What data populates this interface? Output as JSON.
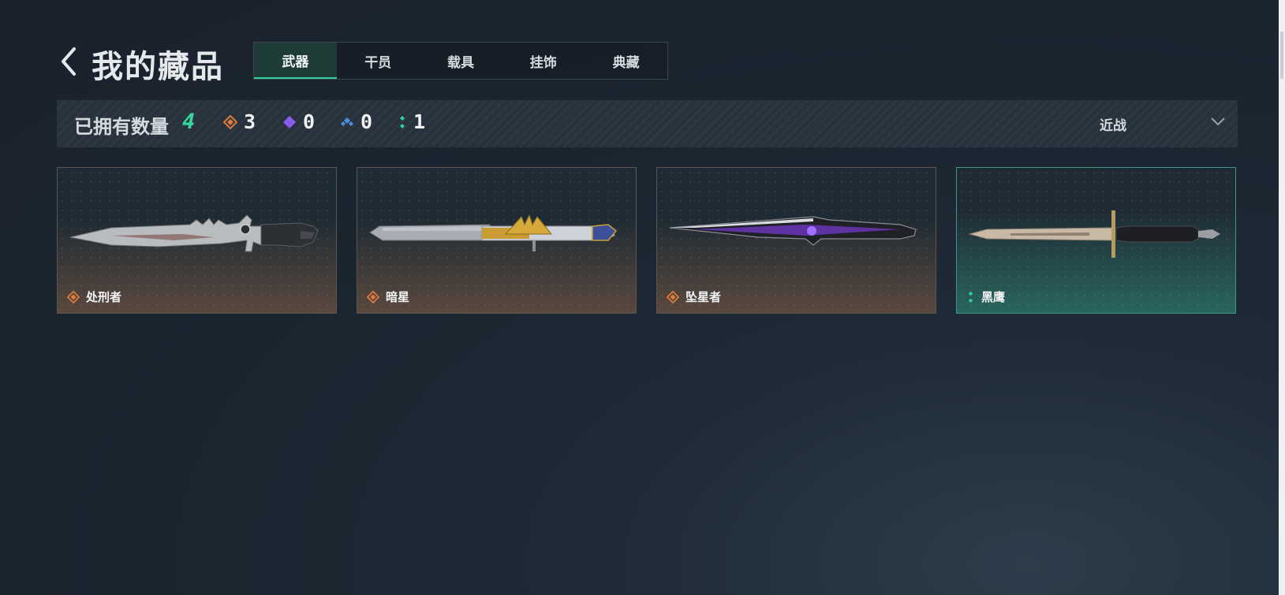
{
  "header": {
    "title": "我的藏品"
  },
  "tabs": [
    {
      "label": "武器",
      "active": true
    },
    {
      "label": "干员",
      "active": false
    },
    {
      "label": "载具",
      "active": false
    },
    {
      "label": "挂饰",
      "active": false
    },
    {
      "label": "典藏",
      "active": false
    }
  ],
  "stats": {
    "owned_label": "已拥有数量",
    "owned_count": "4",
    "rarity_counts": [
      {
        "icon": "orange-diamond-icon",
        "color": "#e07a3c",
        "count": "3"
      },
      {
        "icon": "purple-diamond-icon",
        "color": "#8b5cf0",
        "count": "0"
      },
      {
        "icon": "blue-diamond-icon",
        "color": "#4c8fe0",
        "count": "0"
      },
      {
        "icon": "green-diamond-icon",
        "color": "#2ed59a",
        "count": "1"
      }
    ]
  },
  "filter": {
    "selected": "近战"
  },
  "items": [
    {
      "name": "处刑者",
      "rarity_color": "#e07a3c",
      "rarity_icon": "orange-diamond-icon"
    },
    {
      "name": "暗星",
      "rarity_color": "#e07a3c",
      "rarity_icon": "orange-diamond-icon"
    },
    {
      "name": "坠星者",
      "rarity_color": "#e07a3c",
      "rarity_icon": "orange-diamond-icon"
    },
    {
      "name": "黑鹰",
      "rarity_color": "#2ed59a",
      "rarity_icon": "green-diamond-icon"
    }
  ],
  "colors": {
    "accent": "#2ed59a",
    "background": "#1b2530"
  }
}
